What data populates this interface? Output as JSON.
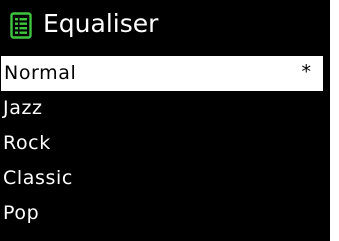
{
  "screen": {
    "title": "Equaliser",
    "title_icon": "list-icon",
    "icon_color": "#3fc43f",
    "selected_mark": "*",
    "items": [
      {
        "label": "Normal",
        "selected": true
      },
      {
        "label": "Jazz",
        "selected": false
      },
      {
        "label": "Rock",
        "selected": false
      },
      {
        "label": "Classic",
        "selected": false
      },
      {
        "label": "Pop",
        "selected": false
      }
    ]
  }
}
